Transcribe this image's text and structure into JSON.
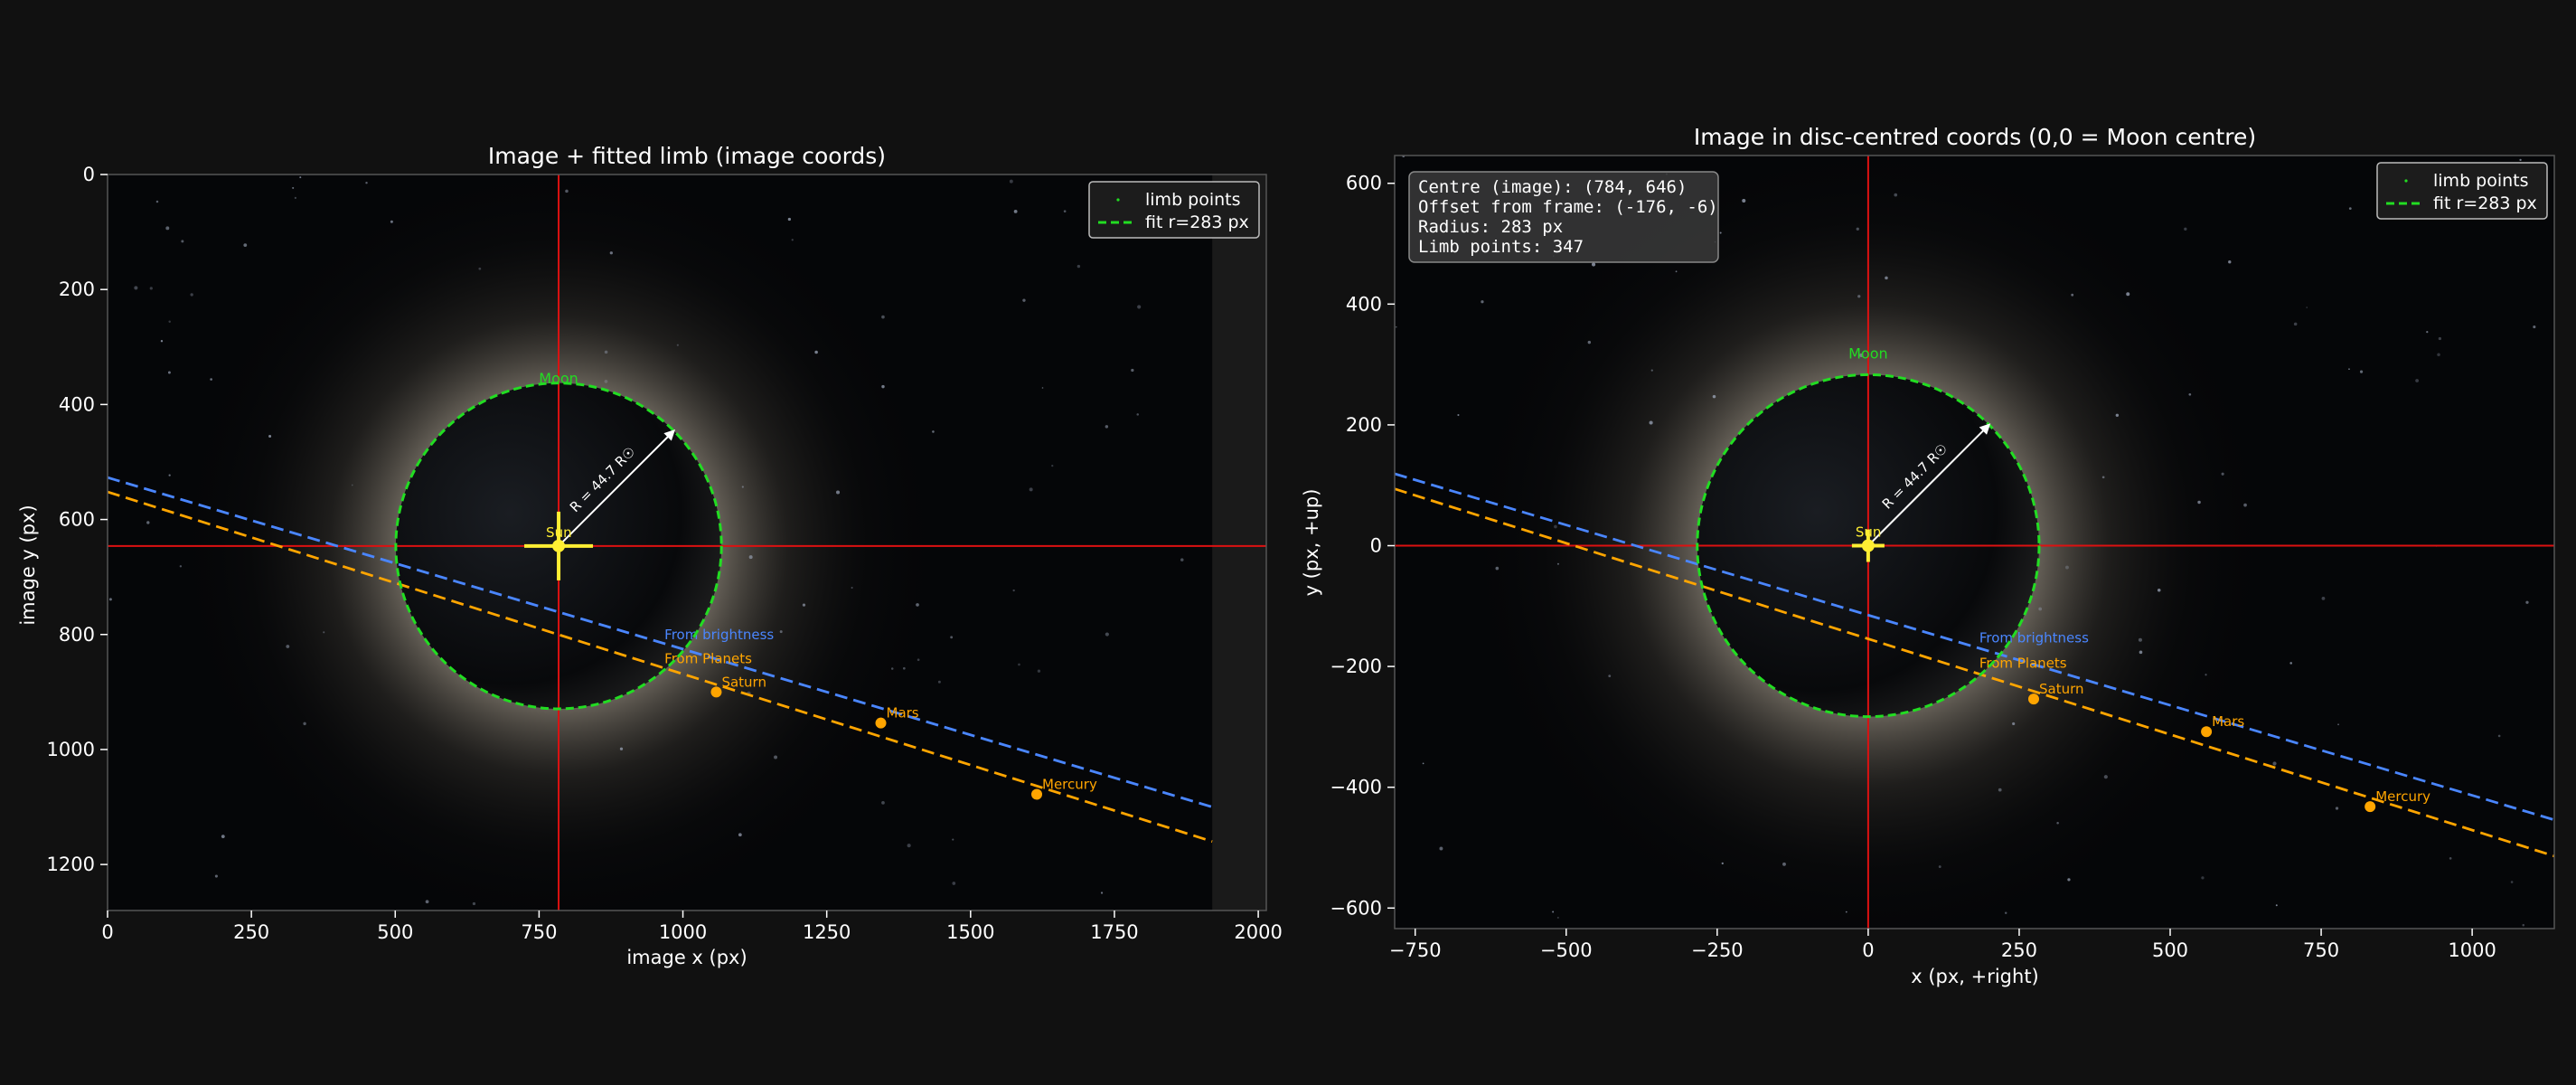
{
  "colors": {
    "background": "#111111",
    "fit": "#22dd22",
    "crosshair": "#dd1111",
    "brightness_line": "#4a86ff",
    "planets_line": "#ffa500",
    "planet": "#ffa500",
    "sun": "#ffee33",
    "moon_label": "#22dd22"
  },
  "chart_data": [
    {
      "type": "scatter",
      "title": "Image + fitted limb  (image coords)",
      "xlabel": "image x  (px)",
      "ylabel": "image y  (px)",
      "xlim": [
        0,
        2014
      ],
      "ylim": [
        1280,
        0
      ],
      "xticks": [
        0,
        250,
        500,
        750,
        1000,
        1250,
        1500,
        1750,
        2000
      ],
      "yticks": [
        0,
        200,
        400,
        600,
        800,
        1000,
        1200
      ],
      "image_extent": [
        0,
        1920,
        1280,
        0
      ],
      "legend": {
        "position": "top-right",
        "entries": [
          "limb points",
          "fit  r=283 px"
        ]
      },
      "fit_circle": {
        "cx": 784,
        "cy": 646,
        "r": 283
      },
      "crosshair": {
        "x": 784,
        "y": 646
      },
      "moon_label": {
        "text": "Moon",
        "x": 784,
        "y": 363
      },
      "radius_arrow": {
        "label": "R = 44.7 R☉",
        "from": [
          784,
          646
        ],
        "to": [
          984,
          446
        ]
      },
      "sun": {
        "label": "Sun",
        "x": 784,
        "y": 646
      },
      "lines": [
        {
          "name": "From brightness",
          "x": [
            0,
            1920
          ],
          "y": [
            527,
            1100
          ],
          "label_at": [
            968,
            808
          ]
        },
        {
          "name": "From Planets",
          "x": [
            0,
            1920
          ],
          "y": [
            552,
            1160
          ],
          "label_at": [
            968,
            850
          ]
        }
      ],
      "planets": [
        {
          "name": "Saturn",
          "x": 1058,
          "y": 900
        },
        {
          "name": "Mars",
          "x": 1344,
          "y": 954
        },
        {
          "name": "Mercury",
          "x": 1615,
          "y": 1078
        }
      ]
    },
    {
      "type": "scatter",
      "title": "Image in disc-centred coords  (0,0 = Moon centre)",
      "xlabel": "x  (px, +right)",
      "ylabel": "y  (px, +up)",
      "xlim": [
        -784,
        1136
      ],
      "ylim": [
        -634,
        646
      ],
      "xticks": [
        -750,
        -500,
        -250,
        0,
        250,
        500,
        750,
        1000
      ],
      "yticks": [
        -600,
        -400,
        -200,
        0,
        200,
        400,
        600
      ],
      "image_extent": [
        -784,
        1136,
        -634,
        646
      ],
      "legend": {
        "position": "top-right",
        "entries": [
          "limb points",
          "fit  r=283 px"
        ]
      },
      "info_box": [
        "Centre (image): (784, 646)",
        "Offset from frame: (-176, -6)",
        "Radius: 283 px",
        "Limb points: 347"
      ],
      "fit_circle": {
        "cx": 0,
        "cy": 0,
        "r": 283
      },
      "crosshair": {
        "x": 0,
        "y": 0
      },
      "moon_label": {
        "text": "Moon",
        "x": 0,
        "y": 310
      },
      "radius_arrow": {
        "label": "R = 44.7 R☉",
        "from": [
          0,
          0
        ],
        "to": [
          200,
          200
        ]
      },
      "sun": {
        "label": "Sun",
        "x": 0,
        "y": 0
      },
      "lines": [
        {
          "name": "From brightness",
          "x": [
            -784,
            1136
          ],
          "y": [
            119,
            -454
          ],
          "label_at": [
            184,
            -160
          ]
        },
        {
          "name": "From Planets",
          "x": [
            -784,
            1136
          ],
          "y": [
            94,
            -514
          ],
          "label_at": [
            184,
            -202
          ]
        }
      ],
      "planets": [
        {
          "name": "Saturn",
          "x": 274,
          "y": -254
        },
        {
          "name": "Mars",
          "x": 560,
          "y": -308
        },
        {
          "name": "Mercury",
          "x": 831,
          "y": -432
        }
      ]
    }
  ]
}
